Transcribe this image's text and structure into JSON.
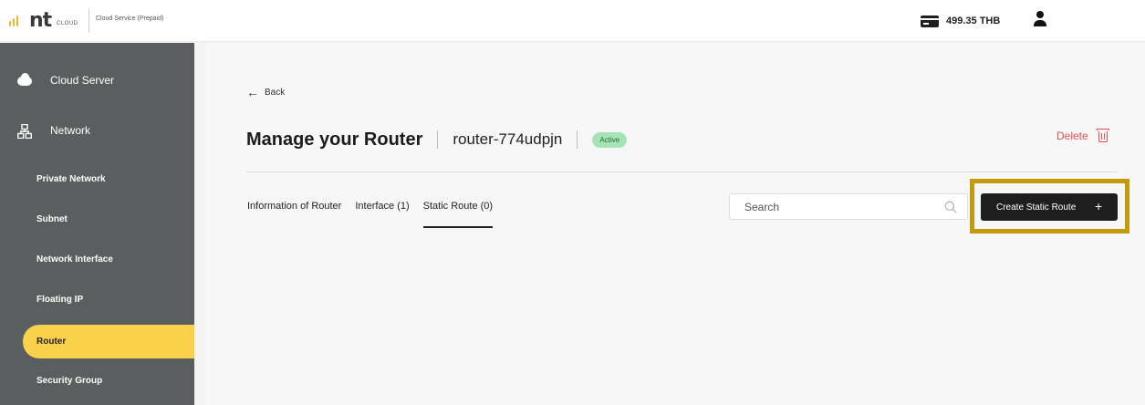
{
  "header": {
    "logo_text": "nt",
    "logo_sub": "CLOUD",
    "service_label": "Cloud Service (Prepaid)",
    "balance": "499.35 THB"
  },
  "sidebar": {
    "main_items": [
      {
        "label": "Cloud Server",
        "icon": "cloud-icon"
      },
      {
        "label": "Network",
        "icon": "network-icon"
      }
    ],
    "sub_items": [
      {
        "label": "Private Network",
        "active": false
      },
      {
        "label": "Subnet",
        "active": false
      },
      {
        "label": "Network Interface",
        "active": false
      },
      {
        "label": "Floating IP",
        "active": false
      },
      {
        "label": "Router",
        "active": true
      },
      {
        "label": "Security Group",
        "active": false
      }
    ]
  },
  "main": {
    "back_label": "Back",
    "title": "Manage your Router",
    "router_name": "router-774udpjn",
    "status": "Active",
    "delete_label": "Delete",
    "tabs": [
      {
        "label": "Information of Router",
        "active": false
      },
      {
        "label": "Interface (1)",
        "active": false
      },
      {
        "label": "Static Route (0)",
        "active": true
      }
    ],
    "search_placeholder": "Search",
    "create_button_label": "Create Static Route",
    "create_button_icon": "+"
  },
  "colors": {
    "sidebar_bg": "#5b5e5e",
    "active_item": "#f9d14b",
    "status_badge": "#a6e3b5",
    "delete_red": "#e35151",
    "highlight": "#c49a0b"
  }
}
